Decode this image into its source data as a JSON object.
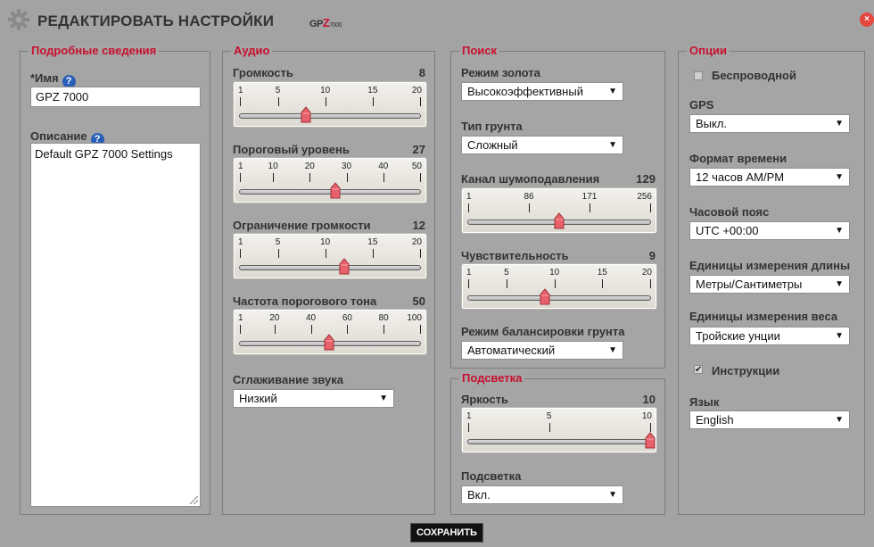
{
  "window": {
    "title": "РЕДАКТИРОВАТЬ НАСТРОЙКИ",
    "logo_prefix": "GP",
    "logo_z": "Z",
    "logo_suffix": "7000",
    "close_symbol": "×"
  },
  "details": {
    "legend": "Подробные сведения",
    "name_label": "*Имя",
    "name_value": "GPZ 7000",
    "description_label": "Описание",
    "description_value": "Default GPZ 7000 Settings",
    "help_symbol": "?"
  },
  "audio": {
    "legend": "Аудио",
    "volume": {
      "label": "Громкость",
      "value": "8",
      "ticks": [
        "1",
        "5",
        "10",
        "15",
        "20"
      ]
    },
    "threshold": {
      "label": "Пороговый уровень",
      "value": "27",
      "ticks": [
        "1",
        "10",
        "20",
        "30",
        "40",
        "50"
      ]
    },
    "volume_limit": {
      "label": "Ограничение громкости",
      "value": "12",
      "ticks": [
        "1",
        "5",
        "10",
        "15",
        "20"
      ]
    },
    "threshold_pitch": {
      "label": "Частота порогового тона",
      "value": "50",
      "ticks": [
        "1",
        "20",
        "40",
        "60",
        "80",
        "100"
      ]
    },
    "smoothing": {
      "label": "Сглаживание звука",
      "selected": "Низкий"
    }
  },
  "search": {
    "legend": "Поиск",
    "gold_mode": {
      "label": "Режим золота",
      "selected": "Высокоэффективный"
    },
    "ground_type": {
      "label": "Тип грунта",
      "selected": "Сложный"
    },
    "noise_channel": {
      "label": "Канал шумоподавления",
      "value": "129",
      "ticks": [
        "1",
        "86",
        "171",
        "256"
      ]
    },
    "sensitivity": {
      "label": "Чувствительность",
      "value": "9",
      "ticks": [
        "1",
        "5",
        "10",
        "15",
        "20"
      ]
    },
    "ground_balance": {
      "label": "Режим балансировки грунта",
      "selected": "Автоматический"
    }
  },
  "backlight": {
    "legend": "Подсветка",
    "brightness": {
      "label": "Яркость",
      "value": "10",
      "ticks": [
        "1",
        "5",
        "10"
      ]
    },
    "backlight": {
      "label": "Подсветка",
      "selected": "Вкл."
    }
  },
  "options": {
    "legend": "Опции",
    "wireless": {
      "label": "Беспроводной",
      "checked": false
    },
    "gps": {
      "label": "GPS",
      "selected": "Выкл."
    },
    "time_format": {
      "label": "Формат времени",
      "selected": "12 часов AM/PM"
    },
    "timezone": {
      "label": "Часовой пояс",
      "selected": "UTC +00:00"
    },
    "length_units": {
      "label": "Единицы измерения длины",
      "selected": "Метры/Сантиметры"
    },
    "weight_units": {
      "label": "Единицы измерения веса",
      "selected": "Тройские унции"
    },
    "instructions": {
      "label": "Инструкции",
      "checked": true,
      "check_symbol": "✔"
    },
    "language": {
      "label": "Язык",
      "selected": "English"
    }
  },
  "footer": {
    "save_label": "СОХРАНИТЬ"
  },
  "colors": {
    "accent": "#c8102e",
    "thumb": "#e8606a",
    "help": "#2a5fb7"
  },
  "icons": {
    "gear": "gear-icon",
    "close": "close-icon",
    "help": "help-icon",
    "dropdown": "chevron-down-icon",
    "resize": "resize-grip-icon",
    "check": "check-icon"
  }
}
